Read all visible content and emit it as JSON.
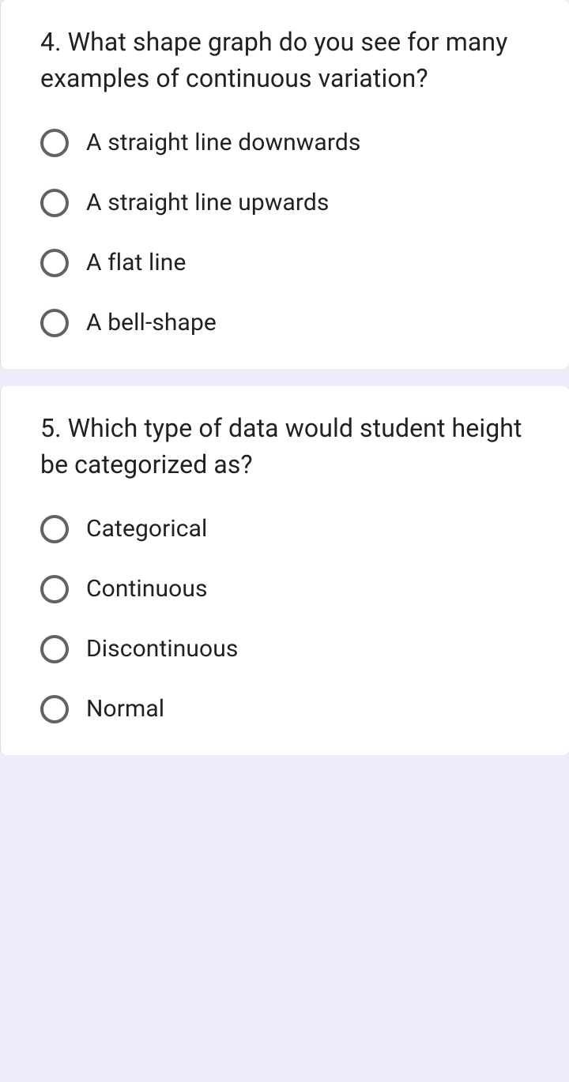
{
  "questions": [
    {
      "title": "4. What shape graph do you see for many examples of continuous variation?",
      "options": [
        "A straight line downwards",
        "A straight line upwards",
        "A flat line",
        "A bell-shape"
      ]
    },
    {
      "title": "5. Which type of data would student height be categorized as?",
      "options": [
        "Categorical",
        "Continuous",
        "Discontinuous",
        "Normal"
      ]
    }
  ]
}
